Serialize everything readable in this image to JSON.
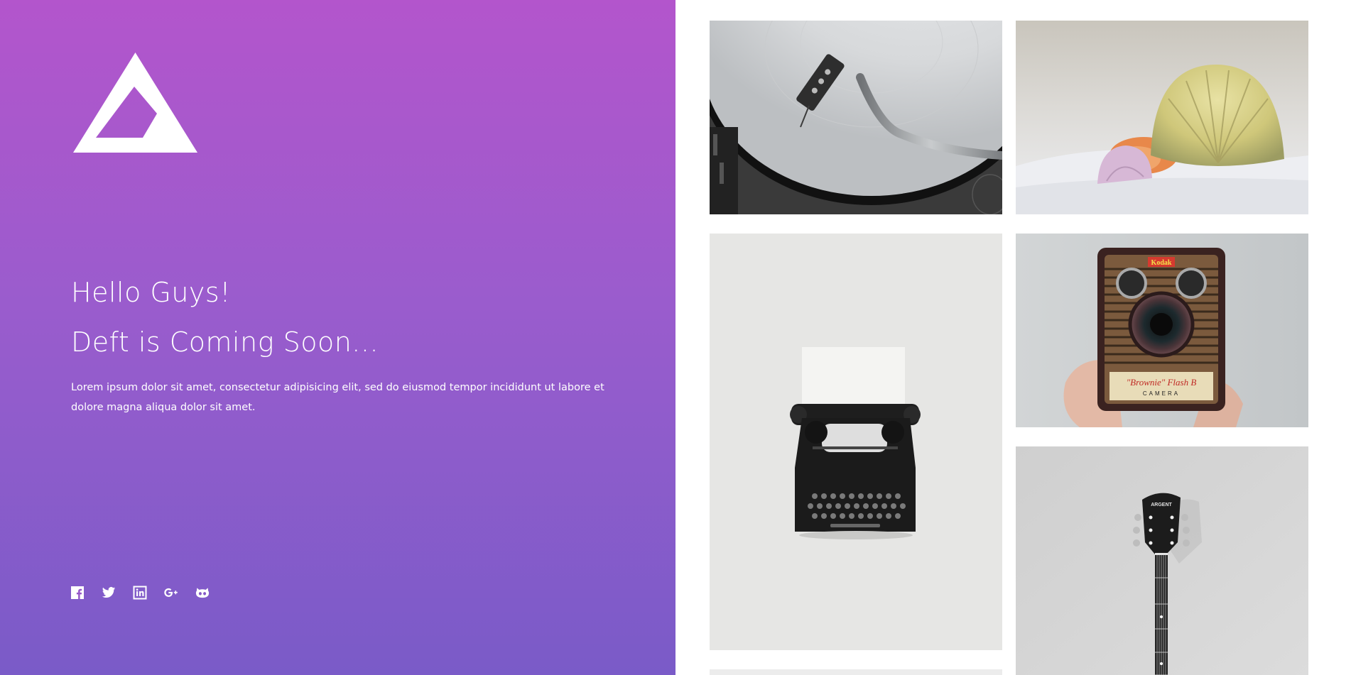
{
  "hero": {
    "background_gradient": [
      "#b355cc",
      "#7a5bc8"
    ],
    "logo_icon": "triangle-logo-icon",
    "heading_line1": "Hello Guys!",
    "heading_line2": "Deft is Coming Soon...",
    "description": "Lorem ipsum dolor sit amet, consectetur adipisicing elit, sed do eiusmod tempor incididunt ut labore et dolore magna aliqua dolor sit amet.",
    "social_icons": [
      "facebook-icon",
      "twitter-icon",
      "linkedin-icon",
      "google-plus-icon",
      "github-icon"
    ]
  },
  "gallery": {
    "images": [
      {
        "name": "record-player-photo"
      },
      {
        "name": "seashells-photo"
      },
      {
        "name": "typewriter-photo"
      },
      {
        "name": "kodak-camera-photo",
        "label_top": "Kodak",
        "label_bottom": "\"Brownie\" Flash B",
        "label_sub": "CAMERA"
      },
      {
        "name": "guitar-headstock-photo",
        "label": "ARGENT"
      },
      {
        "name": "partial-photo"
      }
    ]
  }
}
